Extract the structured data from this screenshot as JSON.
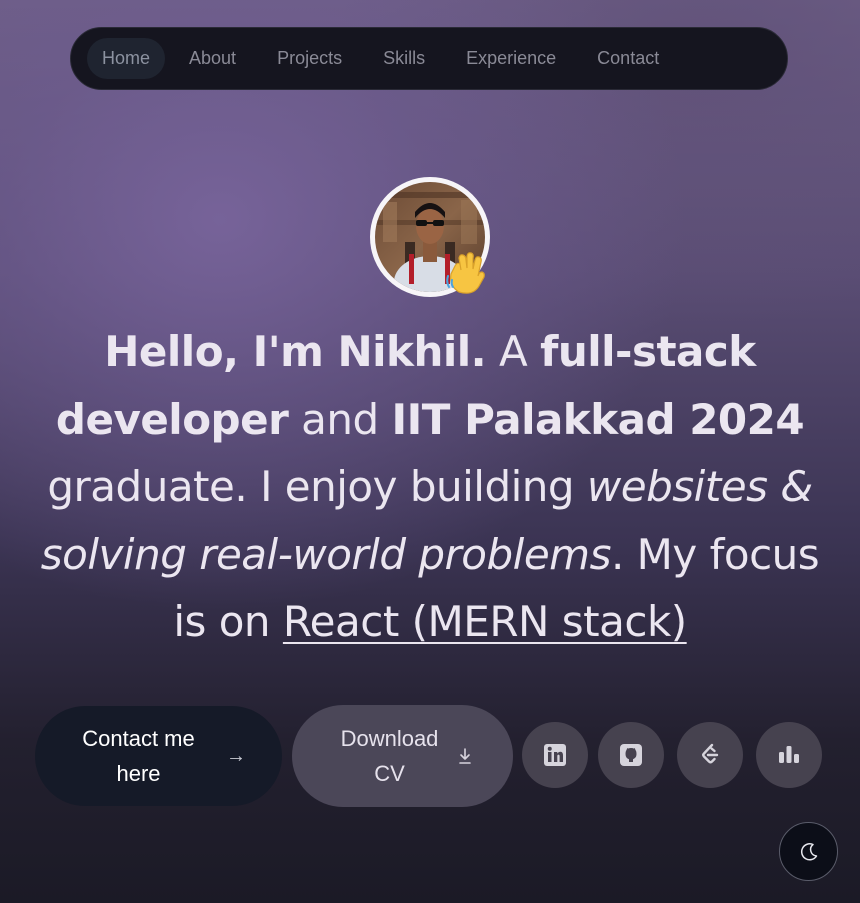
{
  "nav": {
    "items": [
      {
        "label": "Home",
        "active": true
      },
      {
        "label": "About",
        "active": false
      },
      {
        "label": "Projects",
        "active": false
      },
      {
        "label": "Skills",
        "active": false
      },
      {
        "label": "Experience",
        "active": false
      },
      {
        "label": "Contact",
        "active": false
      }
    ]
  },
  "hero": {
    "avatar_icon": "profile-photo",
    "wave_icon": "waving-hand-emoji",
    "headline": {
      "p1": "Hello, I'm Nikhil.",
      "p2": " A ",
      "p3": "full-stack developer",
      "p4": " and ",
      "p5": "IIT Palakkad 2024",
      "p6": " graduate. I enjoy building ",
      "p7": "websites & solving real-world problems",
      "p8": ". My focus is on ",
      "p9": "React (MERN stack)"
    }
  },
  "actions": {
    "contact_label": "Contact me here",
    "contact_icon": "arrow-right-icon",
    "cv_label": "Download CV",
    "cv_icon": "download-icon"
  },
  "social": [
    {
      "name": "linkedin-icon"
    },
    {
      "name": "github-icon"
    },
    {
      "name": "leetcode-icon"
    },
    {
      "name": "bar-chart-icon"
    }
  ],
  "theme_toggle_icon": "moon-icon",
  "colors": {
    "nav_bg": "#15151f",
    "contact_bg": "#151a28",
    "cv_bg": "#4b4758",
    "social_bg": "#46424f",
    "text": "#ebe6f0"
  }
}
